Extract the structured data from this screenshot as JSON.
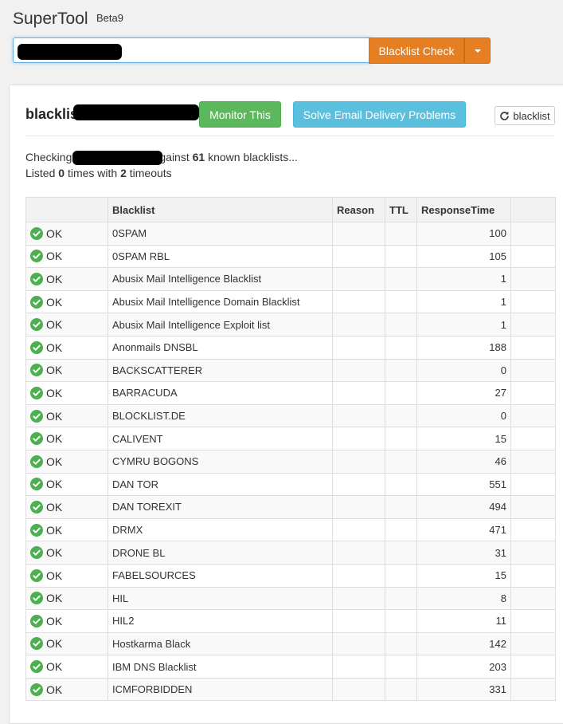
{
  "app": {
    "title": "SuperTool",
    "badge": "Beta9"
  },
  "search": {
    "value": "",
    "button_label": "Blacklist Check"
  },
  "result": {
    "title_prefix": "blacklis",
    "monitor_label": "Monitor This",
    "solve_label": "Solve Email Delivery Problems",
    "refresh_label": "blacklist",
    "checking_prefix": "Checking",
    "checking_middle": "gainst",
    "checking_count": "61",
    "checking_suffix": "known blacklists...",
    "listed_prefix": "Listed",
    "listed_count": "0",
    "listed_middle": "times with",
    "timeouts_count": "2",
    "timeouts_suffix": "timeouts"
  },
  "table": {
    "headers": [
      "",
      "Blacklist",
      "Reason",
      "TTL",
      "ResponseTime",
      ""
    ],
    "rows": [
      {
        "status": "OK",
        "name": "0SPAM",
        "reason": "",
        "ttl": "",
        "time": "100"
      },
      {
        "status": "OK",
        "name": "0SPAM RBL",
        "reason": "",
        "ttl": "",
        "time": "105"
      },
      {
        "status": "OK",
        "name": "Abusix Mail Intelligence Blacklist",
        "reason": "",
        "ttl": "",
        "time": "1"
      },
      {
        "status": "OK",
        "name": "Abusix Mail Intelligence Domain Blacklist",
        "reason": "",
        "ttl": "",
        "time": "1"
      },
      {
        "status": "OK",
        "name": "Abusix Mail Intelligence Exploit list",
        "reason": "",
        "ttl": "",
        "time": "1"
      },
      {
        "status": "OK",
        "name": "Anonmails DNSBL",
        "reason": "",
        "ttl": "",
        "time": "188"
      },
      {
        "status": "OK",
        "name": "BACKSCATTERER",
        "reason": "",
        "ttl": "",
        "time": "0"
      },
      {
        "status": "OK",
        "name": "BARRACUDA",
        "reason": "",
        "ttl": "",
        "time": "27"
      },
      {
        "status": "OK",
        "name": "BLOCKLIST.DE",
        "reason": "",
        "ttl": "",
        "time": "0"
      },
      {
        "status": "OK",
        "name": "CALIVENT",
        "reason": "",
        "ttl": "",
        "time": "15"
      },
      {
        "status": "OK",
        "name": "CYMRU BOGONS",
        "reason": "",
        "ttl": "",
        "time": "46"
      },
      {
        "status": "OK",
        "name": "DAN TOR",
        "reason": "",
        "ttl": "",
        "time": "551"
      },
      {
        "status": "OK",
        "name": "DAN TOREXIT",
        "reason": "",
        "ttl": "",
        "time": "494"
      },
      {
        "status": "OK",
        "name": "DRMX",
        "reason": "",
        "ttl": "",
        "time": "471"
      },
      {
        "status": "OK",
        "name": "DRONE BL",
        "reason": "",
        "ttl": "",
        "time": "31"
      },
      {
        "status": "OK",
        "name": "FABELSOURCES",
        "reason": "",
        "ttl": "",
        "time": "15"
      },
      {
        "status": "OK",
        "name": "HIL",
        "reason": "",
        "ttl": "",
        "time": "8"
      },
      {
        "status": "OK",
        "name": "HIL2",
        "reason": "",
        "ttl": "",
        "time": "11"
      },
      {
        "status": "OK",
        "name": "Hostkarma Black",
        "reason": "",
        "ttl": "",
        "time": "142"
      },
      {
        "status": "OK",
        "name": "IBM DNS Blacklist",
        "reason": "",
        "ttl": "",
        "time": "203"
      },
      {
        "status": "OK",
        "name": "ICMFORBIDDEN",
        "reason": "",
        "ttl": "",
        "time": "331"
      }
    ]
  },
  "colors": {
    "accent_orange": "#e67e22",
    "success_green": "#5cb85c",
    "info_blue": "#5bc0de",
    "ok_icon_green": "#4caf50"
  }
}
